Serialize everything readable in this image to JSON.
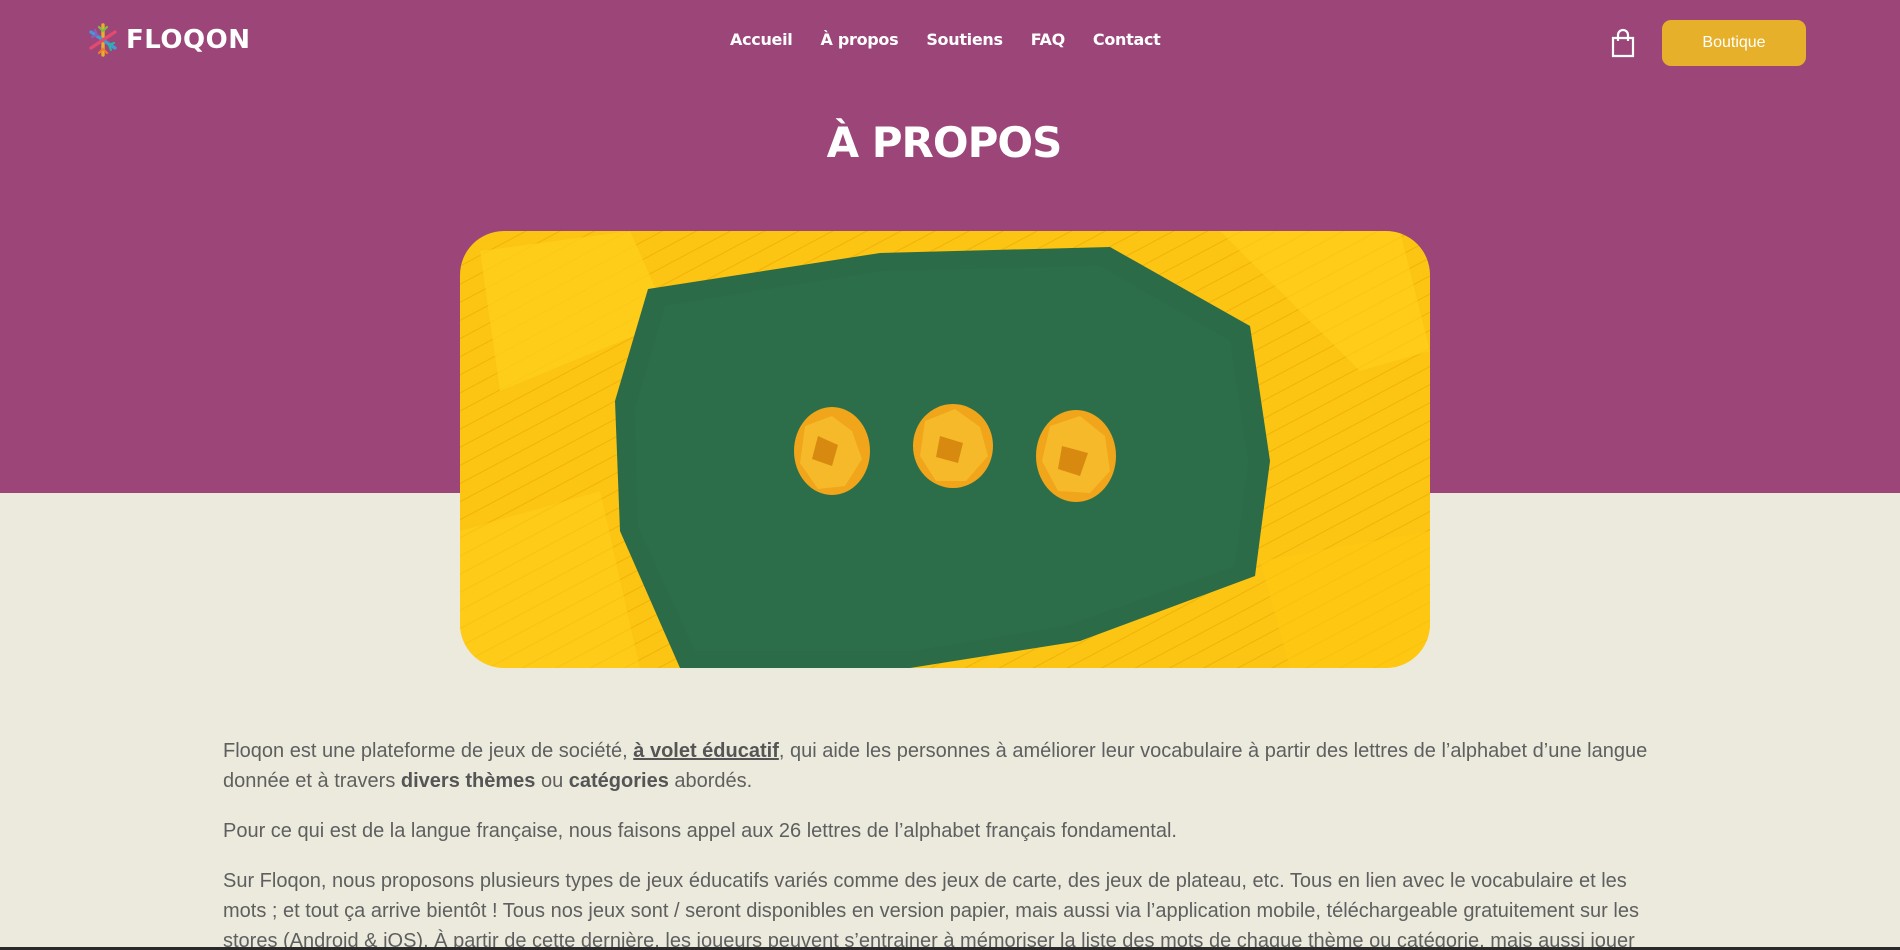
{
  "header": {
    "logo_text": "FLOQON",
    "nav": [
      "Accueil",
      "À propos",
      "Soutiens",
      "FAQ",
      "Contact"
    ],
    "shop_label": "Boutique",
    "cart_icon": "shopping-bag-icon"
  },
  "page": {
    "title": "À PROPOS"
  },
  "colors": {
    "header_bg": "#9b4579",
    "page_bg": "#ebeadd",
    "button": "#e7b02a",
    "text": "#5f5f5f"
  },
  "content": {
    "p1": {
      "a": "Floqon est une plateforme de jeux de société, ",
      "link": "à volet éducatif",
      "b": ", qui aide les personnes à améliorer leur vocabulaire à partir des lettres de l’alphabet d’une langue donnée et à travers ",
      "bold1": "divers thèmes",
      "c": " ou ",
      "bold2": "catégories",
      "d": " abordés."
    },
    "p2": "Pour ce qui est de la langue française, nous faisons appel aux 26 lettres de l’alphabet français fondamental.",
    "p3": "Sur Floqon, nous proposons plusieurs types de jeux éducatifs variés comme des jeux de carte, des jeux de plateau, etc. Tous en lien avec le vocabulaire et les mots ; et tout ça arrive bientôt ! Tous nos jeux sont / seront disponibles en version papier, mais aussi via l’application mobile, téléchargeable gratuitement sur les stores (Android & iOS). À partir de cette dernière, les joueurs peuvent s’entrainer à mémoriser la liste des mots de chaque thème ou catégorie, mais aussi jouer"
  }
}
